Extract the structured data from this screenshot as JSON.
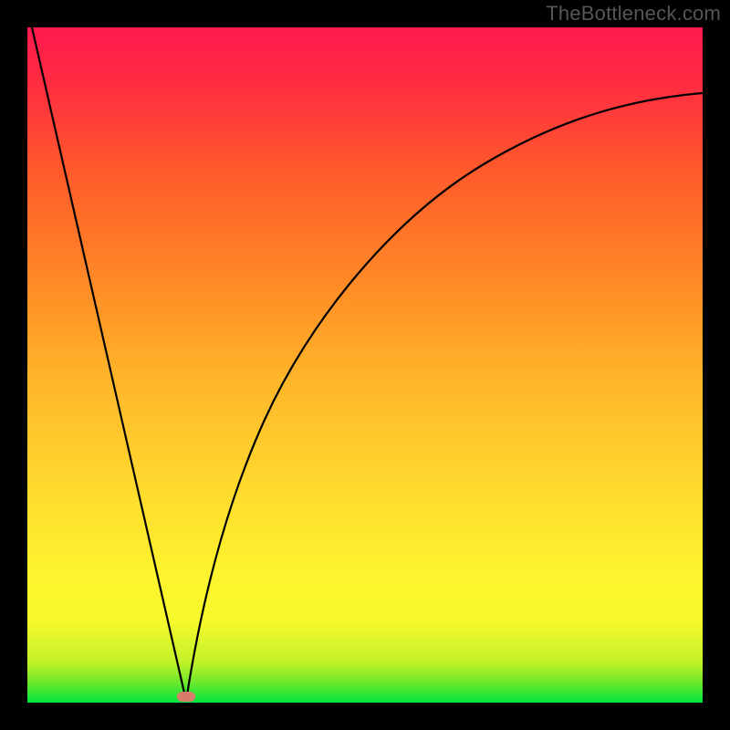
{
  "watermark": "TheBottleneck.com",
  "colors": {
    "frame": "#000000",
    "curve": "#000000",
    "marker": "#d77c6d",
    "gradient_top": "#ff1a4e",
    "gradient_bottom": "#00e640"
  },
  "chart_data": {
    "type": "line",
    "title": "",
    "xlabel": "",
    "ylabel": "",
    "xlim": [
      0,
      100
    ],
    "ylim": [
      0,
      100
    ],
    "grid": false,
    "legend": false,
    "annotations": [],
    "series": [
      {
        "name": "left-linear",
        "x": [
          0,
          5,
          10,
          15,
          20,
          23.5
        ],
        "values": [
          100,
          78.7,
          57.4,
          36.2,
          14.9,
          0
        ]
      },
      {
        "name": "right-curve",
        "x": [
          23.5,
          25,
          27,
          30,
          34,
          38,
          44,
          50,
          58,
          66,
          74,
          82,
          90,
          100
        ],
        "values": [
          0,
          9,
          19,
          30,
          41,
          50,
          59,
          66,
          72.5,
          77.5,
          81.5,
          84.8,
          87.5,
          90
        ]
      }
    ],
    "marker": {
      "x": 23.5,
      "y": 0
    }
  }
}
